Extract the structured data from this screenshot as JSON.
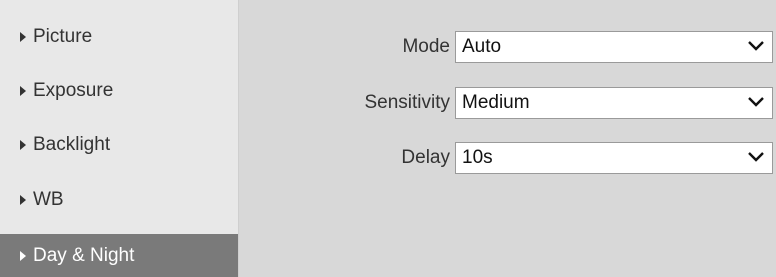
{
  "sidebar": {
    "items": [
      {
        "label": "Picture",
        "active": false
      },
      {
        "label": "Exposure",
        "active": false
      },
      {
        "label": "Backlight",
        "active": false
      },
      {
        "label": "WB",
        "active": false
      },
      {
        "label": "Day & Night",
        "active": true
      }
    ]
  },
  "form": {
    "mode": {
      "label": "Mode",
      "value": "Auto"
    },
    "sensitivity": {
      "label": "Sensitivity",
      "value": "Medium"
    },
    "delay": {
      "label": "Delay",
      "value": "10s"
    }
  },
  "icons": {
    "menu_bullet": "triangle-right-icon",
    "select_arrow": "chevron-down-icon"
  }
}
